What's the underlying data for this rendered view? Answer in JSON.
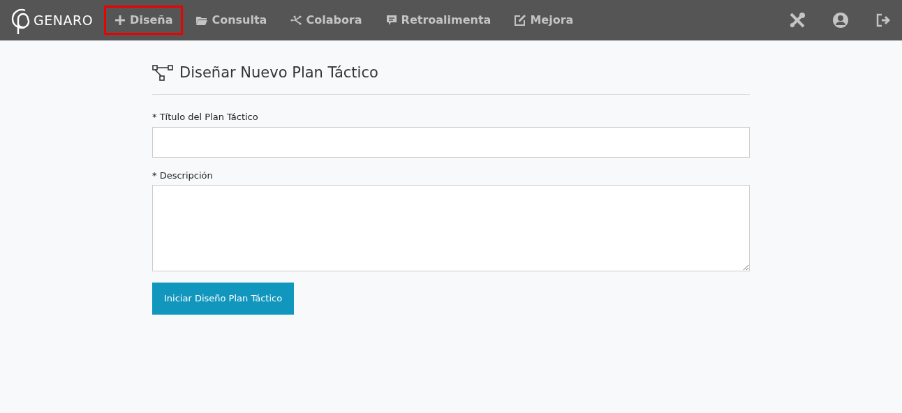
{
  "brand": "GENARO",
  "nav": [
    {
      "label": "Diseña",
      "kind": "plus",
      "highlighted": true
    },
    {
      "label": "Consulta",
      "kind": "folder",
      "highlighted": false
    },
    {
      "label": "Colabora",
      "kind": "network",
      "highlighted": false
    },
    {
      "label": "Retroalimenta",
      "kind": "comment",
      "highlighted": false
    },
    {
      "label": "Mejora",
      "kind": "edit",
      "highlighted": false
    }
  ],
  "tools": [
    {
      "kind": "tools"
    },
    {
      "kind": "user"
    },
    {
      "kind": "logout"
    }
  ],
  "heading": "Diseñar Nuevo Plan Táctico",
  "fields": [
    {
      "label": "* Título del Plan Táctico",
      "kind": "input"
    },
    {
      "label": "* Descripción",
      "kind": "textarea"
    }
  ],
  "submit": "Iniciar Diseño Plan Táctico"
}
